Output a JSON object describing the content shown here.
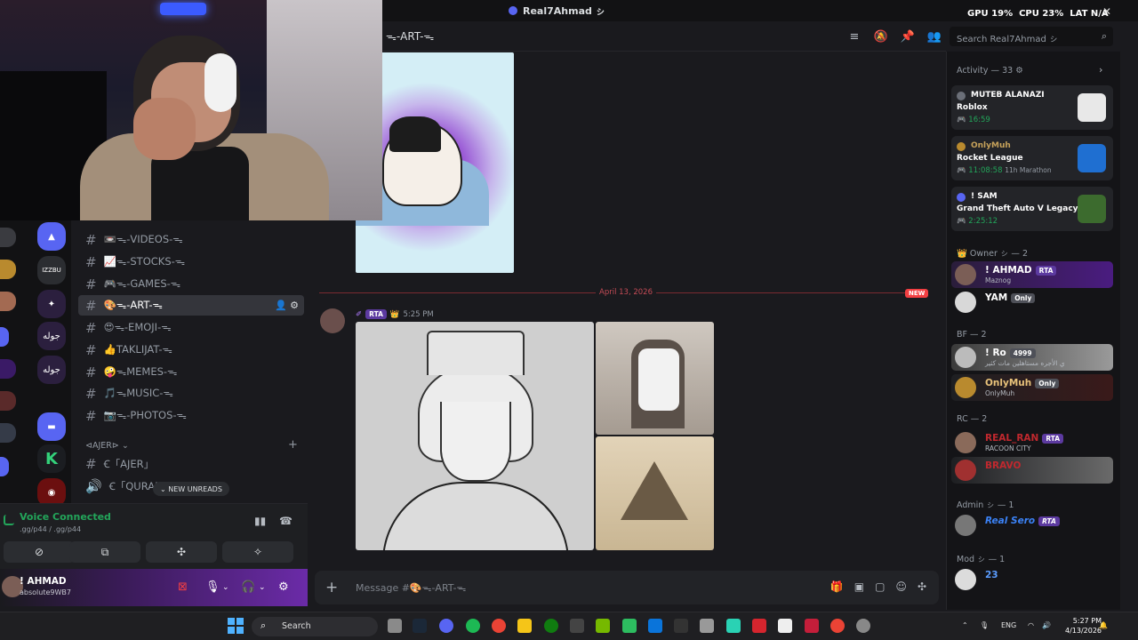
{
  "window": {
    "title": "Real7Ahmad ㇱ",
    "stats": {
      "gpu_label": "GPU",
      "gpu": "19%",
      "cpu_label": "CPU",
      "cpu": "23%",
      "lat_label": "LAT",
      "lat": "N/A"
    }
  },
  "header": {
    "channel": "ᯓ-ART-ᯓ",
    "search_placeholder": "Search Real7Ahmad ㇱ"
  },
  "rail": {
    "labels": [
      "IZZBU",
      "جوله",
      "جوله"
    ]
  },
  "channels": {
    "items": [
      {
        "label": "📼ᯓ-VIDEOS-ᯓ"
      },
      {
        "label": "📈ᯓ-STOCKS-ᯓ"
      },
      {
        "label": "🎮ᯓ-GAMES-ᯓ"
      },
      {
        "label": "🎨ᯓ-ART-ᯓ"
      },
      {
        "label": "😍ᯓ-EMOJI-ᯓ"
      },
      {
        "label": "👍TAKLIJAT-ᯓ"
      },
      {
        "label": "🤪ᯓMEMES-ᯓ"
      },
      {
        "label": "🎵ᯓMUSIC-ᯓ"
      },
      {
        "label": "📷ᯓ-PHOTOS-ᯓ"
      }
    ],
    "category": "⊲AJER⊳",
    "cat_items": [
      {
        "label": "Ꞓ「AJER」"
      },
      {
        "label": "Ꞓ「QURAN"
      }
    ],
    "new_unreads": "NEW UNREADS"
  },
  "voice": {
    "status": "Voice Connected",
    "sub": ".gg/p44 / .gg/p44"
  },
  "user": {
    "name": "! AHMAD",
    "status": "absolute9WB7"
  },
  "messages": {
    "divider_date": "April 13, 2026",
    "new_badge": "NEW",
    "author_tag": "RTA",
    "time": "5:25 PM"
  },
  "composer": {
    "placeholder": "Message #🎨ᯓ-ART-ᯓ"
  },
  "activity": {
    "header": "Activity — 33",
    "cards": [
      {
        "who": "MUTEB ALANAZI",
        "game": "Roblox",
        "time": "16:59",
        "extra": ""
      },
      {
        "who": "OnlyMuh",
        "game": "Rocket League",
        "time": "11:08:58",
        "extra": "11h Marathon"
      },
      {
        "who": "! SAM",
        "game": "Grand Theft Auto V Legacy",
        "time": "2:25:12",
        "extra": ""
      }
    ]
  },
  "members": {
    "owner_group": "Owner ㇱ — 2",
    "owner": [
      {
        "name": "! AHMAD",
        "tag": "RTA",
        "sub": "Maznog"
      },
      {
        "name": "YAM",
        "tag": "Only",
        "sub": ""
      }
    ],
    "bf_group": "BF — 2",
    "bf": [
      {
        "name": "! Ro",
        "tag": "4999",
        "sub": "ي الأجره مستاهلين مات كثير"
      },
      {
        "name": "OnlyMuh",
        "tag": "Only",
        "sub": "OnlyMuh"
      }
    ],
    "rc_group": "RC — 2",
    "rc": [
      {
        "name": "REAL_RAN",
        "tag": "RTA",
        "sub": "RACOON CITY"
      },
      {
        "name": "BRAVO",
        "tag": "",
        "sub": ""
      }
    ],
    "admin_group": "Admin ㇱ — 1",
    "admin": [
      {
        "name": "Real Sero",
        "tag": "RTA",
        "sub": ""
      }
    ],
    "mod_group": "Mod ㇱ — 1",
    "mod": [
      {
        "name": "23",
        "tag": "",
        "sub": ""
      }
    ]
  },
  "taskbar": {
    "search": "Search",
    "lang": "ENG",
    "time": "5:27 PM",
    "date": "4/13/2026"
  }
}
